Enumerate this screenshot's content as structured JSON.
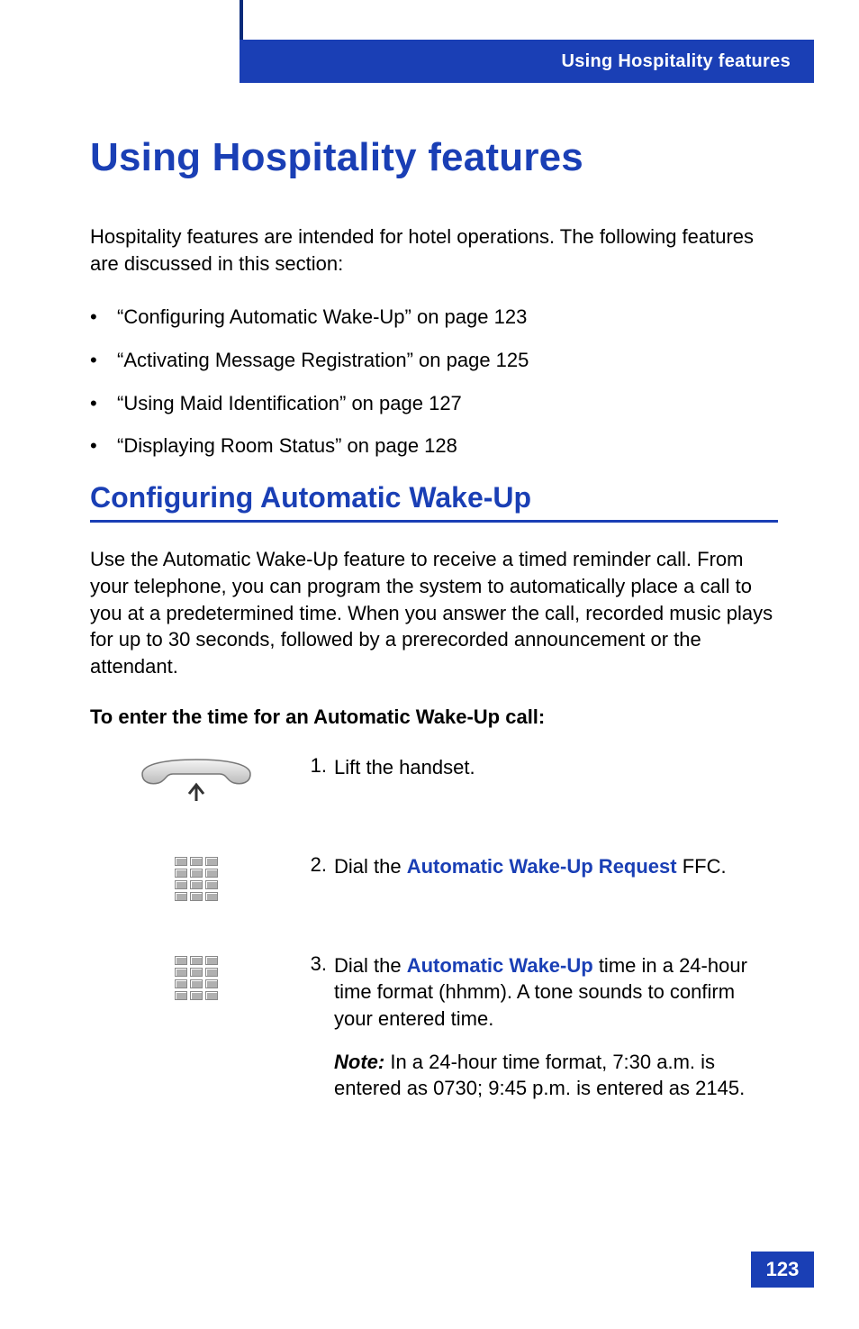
{
  "header": {
    "running_title": "Using Hospitality features"
  },
  "title": "Using Hospitality features",
  "intro": "Hospitality features are intended for hotel operations. The following features are discussed in this section:",
  "bullets": [
    "“Configuring Automatic Wake-Up” on page 123",
    "“Activating Message Registration” on page 125",
    "“Using Maid Identification” on page 127",
    "“Displaying Room Status” on page 128"
  ],
  "section": {
    "title": "Configuring Automatic Wake-Up",
    "desc": "Use the Automatic Wake-Up feature to receive a timed reminder call. From your telephone, you can program the system to automatically place a call to you at a predetermined time. When you answer the call, recorded music plays for up to 30 seconds, followed by a prerecorded announcement or the attendant.",
    "subhead": "To enter the time for an Automatic Wake-Up call:",
    "steps": [
      {
        "num": "1.",
        "pre": "",
        "hl": "",
        "post": "Lift the handset.",
        "icon": "handset"
      },
      {
        "num": "2.",
        "pre": "Dial the ",
        "hl": "Automatic Wake-Up Request",
        "post": " FFC.",
        "icon": "keypad"
      },
      {
        "num": "3.",
        "pre": "Dial the ",
        "hl": "Automatic Wake-Up",
        "post": " time in a 24-hour time format (hhmm). A tone sounds to confirm your entered time.",
        "icon": "keypad"
      }
    ],
    "note": {
      "label": "Note:",
      "text": " In a 24-hour time format, 7:30 a.m. is entered as 0730; 9:45 p.m. is entered as 2145."
    }
  },
  "page_number": "123"
}
